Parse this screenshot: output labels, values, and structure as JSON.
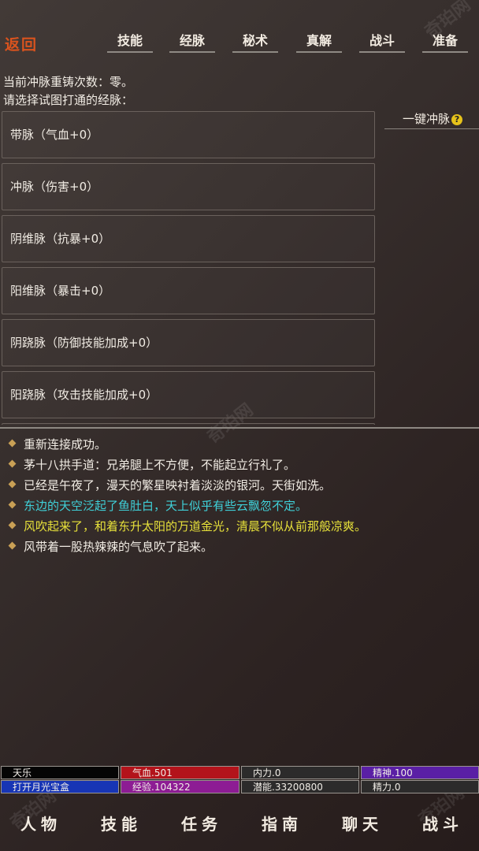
{
  "header": {
    "back_label": "返回",
    "tabs": [
      {
        "label": "技能"
      },
      {
        "label": "经脉"
      },
      {
        "label": "秘术"
      },
      {
        "label": "真解"
      },
      {
        "label": "战斗"
      },
      {
        "label": "准备"
      }
    ]
  },
  "info": {
    "reforge_count": "当前冲脉重铸次数：零。",
    "prompt": "请选择试图打通的经脉："
  },
  "meridians": [
    {
      "label": "带脉（气血+0）"
    },
    {
      "label": "冲脉（伤害+0）"
    },
    {
      "label": "阴维脉（抗暴+0）"
    },
    {
      "label": "阳维脉（暴击+0）"
    },
    {
      "label": "阴跷脉（防御技能加成+0）"
    },
    {
      "label": "阳跷脉（攻击技能加成+0）"
    }
  ],
  "one_click": {
    "label": "一键冲脉",
    "help_glyph": "?"
  },
  "messages": [
    {
      "text": "重新连接成功。",
      "color": "#f1ece4"
    },
    {
      "text": "茅十八拱手道：兄弟腿上不方便，不能起立行礼了。",
      "color": "#f1ece4"
    },
    {
      "text": "已经是午夜了，漫天的繁星映衬着淡淡的银河。天街如洗。",
      "color": "#f1ece4"
    },
    {
      "text": "东边的天空泛起了鱼肚白，天上似乎有些云飘忽不定。",
      "color": "#3fd0d8"
    },
    {
      "text": "风吹起来了，和着东升太阳的万道金光，清晨不似从前那般凉爽。",
      "color": "#e6e03a"
    },
    {
      "text": "风带着一股热辣辣的气息吹了起来。",
      "color": "#f1ece4"
    }
  ],
  "status": {
    "name": "天乐",
    "hp": "气血.501",
    "neili": "内力.0",
    "spirit": "精神.100",
    "treasure": "打开月光宝盒",
    "exp": "经验.104322",
    "potential": "潜能.33200800",
    "jingli": "精力.0",
    "colors": {
      "name": "#050505",
      "hp": "#b3131b",
      "neili": "#2c2b2b",
      "spirit": "#5a1fa5",
      "treasure": "#1735b5",
      "exp": "#8d1c94",
      "potential": "#2c2b2b",
      "jingli": "#2c2b2b"
    }
  },
  "bottom_nav": [
    {
      "label": "人物"
    },
    {
      "label": "技能"
    },
    {
      "label": "任务"
    },
    {
      "label": "指南"
    },
    {
      "label": "聊天"
    },
    {
      "label": "战斗"
    }
  ]
}
